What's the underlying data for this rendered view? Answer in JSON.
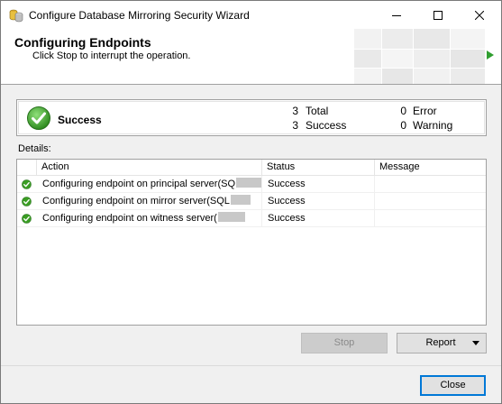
{
  "window": {
    "title": "Configure Database Mirroring Security Wizard",
    "icon": "database-wizard-icon"
  },
  "header": {
    "title": "Configuring Endpoints",
    "subtitle": "Click Stop to interrupt the operation."
  },
  "summary": {
    "status": "Success",
    "total_count": "3",
    "total_label": "Total",
    "success_count": "3",
    "success_label": "Success",
    "error_count": "0",
    "error_label": "Error",
    "warning_count": "0",
    "warning_label": "Warning"
  },
  "details": {
    "label": "Details:",
    "columns": [
      "Action",
      "Status",
      "Message"
    ],
    "rows": [
      {
        "action": "Configuring endpoint on principal server(SQ",
        "status": "Success",
        "message": ""
      },
      {
        "action": "Configuring endpoint on mirror server(SQL",
        "status": "Success",
        "message": ""
      },
      {
        "action": "Configuring endpoint on witness server(",
        "status": "Success",
        "message": ""
      }
    ]
  },
  "buttons": {
    "stop": "Stop",
    "report": "Report",
    "close": "Close"
  },
  "colors": {
    "success_green": "#3a9d23",
    "accent_blue": "#0078d7"
  }
}
